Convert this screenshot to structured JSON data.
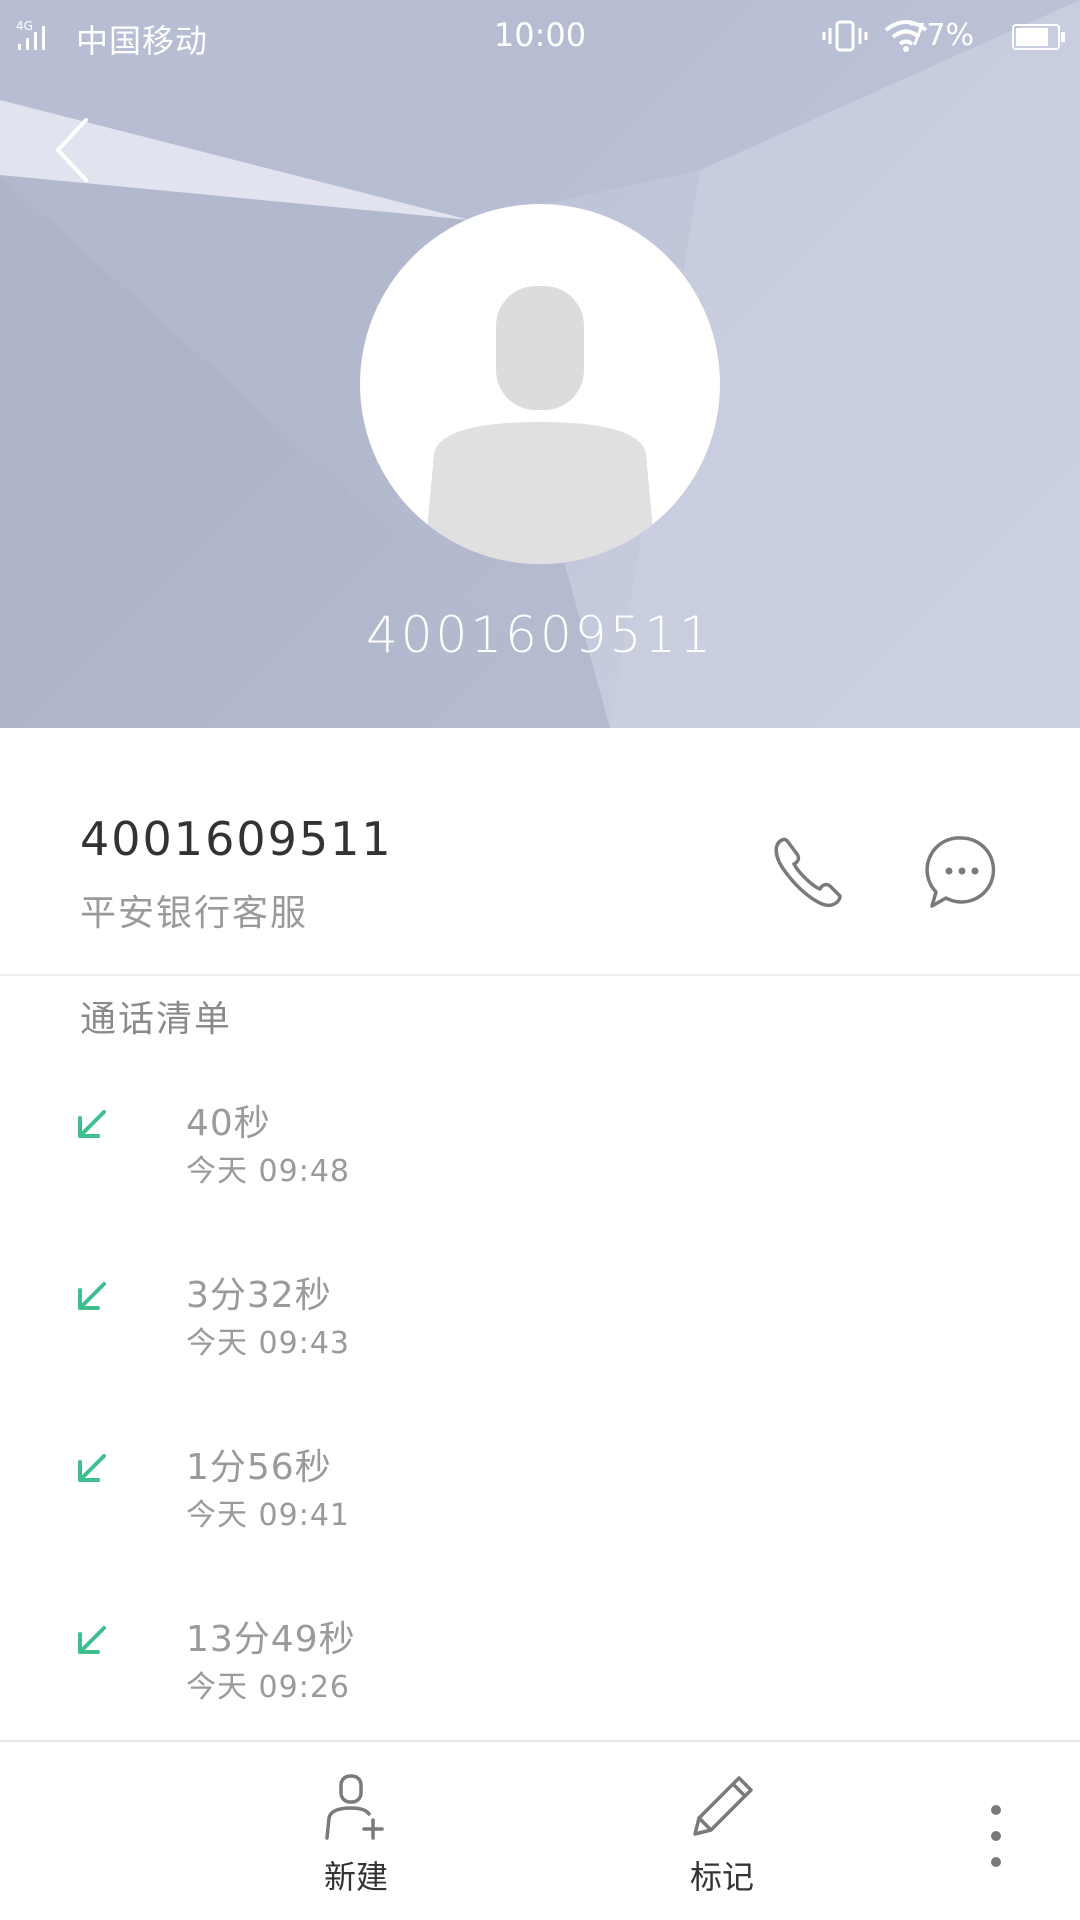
{
  "status_bar": {
    "network": "4G",
    "carrier": "中国移动",
    "time": "10:00",
    "battery": "77%"
  },
  "header": {
    "number": "4001609511"
  },
  "contact": {
    "number": "4001609511",
    "name": "平安银行客服"
  },
  "calls": {
    "title": "通话清单",
    "items": [
      {
        "duration": "40秒",
        "when": "今天 09:48",
        "type": "incoming"
      },
      {
        "duration": "3分32秒",
        "when": "今天 09:43",
        "type": "incoming"
      },
      {
        "duration": "1分56秒",
        "when": "今天 09:41",
        "type": "incoming"
      },
      {
        "duration": "13分49秒",
        "when": "今天 09:26",
        "type": "incoming"
      }
    ]
  },
  "bottom_bar": {
    "new_label": "新建",
    "mark_label": "标记"
  },
  "colors": {
    "incoming_arrow": "#3fbf8f",
    "header_bg": "#b7bdd2"
  }
}
